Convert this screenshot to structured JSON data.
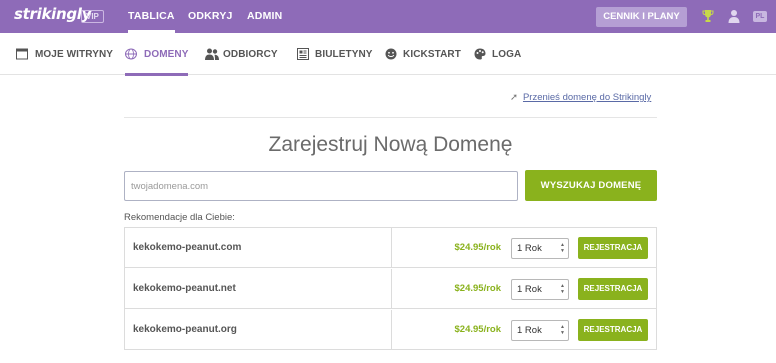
{
  "brand": {
    "logo": "strikingly",
    "badge": "VIP"
  },
  "topnav": {
    "items": [
      {
        "label": "TABLICA",
        "active": true
      },
      {
        "label": "ODKRYJ",
        "active": false
      },
      {
        "label": "ADMIN",
        "active": false
      }
    ],
    "pricing_label": "CENNIK I PLANY",
    "lang": "PL",
    "icons": [
      "trophy-icon",
      "user-icon"
    ]
  },
  "subnav": {
    "items": [
      {
        "label": "MOJE WITRYNY",
        "icon": "window-icon",
        "active": false
      },
      {
        "label": "DOMENY",
        "icon": "globe-icon",
        "active": true
      },
      {
        "label": "ODBIORCY",
        "icon": "users-icon",
        "active": false
      },
      {
        "label": "BIULETYNY",
        "icon": "newsletter-icon",
        "active": false
      },
      {
        "label": "KICKSTART",
        "icon": "smile-icon",
        "active": false
      },
      {
        "label": "LOGA",
        "icon": "palette-icon",
        "active": false
      }
    ]
  },
  "content": {
    "transfer_link": "Przenieś domenę do Strikingly",
    "heading": "Zarejestruj Nową Domenę",
    "search_placeholder": "twojadomena.com",
    "search_button": "WYSZUKAJ DOMENĘ",
    "recommendations_label": "Rekomendacje dla Ciebie:",
    "register_label": "REJESTRACJA",
    "rows": [
      {
        "domain": "kekokemo-peanut.com",
        "price": "$24.95/rok",
        "period": "1 Rok"
      },
      {
        "domain": "kekokemo-peanut.net",
        "price": "$24.95/rok",
        "period": "1 Rok"
      },
      {
        "domain": "kekokemo-peanut.org",
        "price": "$24.95/rok",
        "period": "1 Rok"
      }
    ]
  },
  "colors": {
    "brand_purple": "#8e6bb8",
    "accent_green": "#8ab21d",
    "link_blue": "#5a6aa6"
  }
}
